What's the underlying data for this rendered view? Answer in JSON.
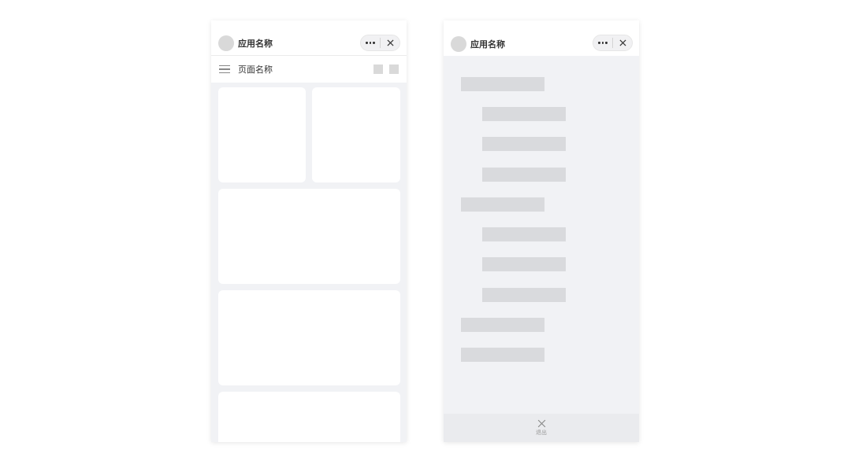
{
  "left_phone": {
    "app_name": "应用名称",
    "page_name": "页面名称"
  },
  "right_phone": {
    "app_name": "应用名称",
    "exit_label": "退出"
  }
}
